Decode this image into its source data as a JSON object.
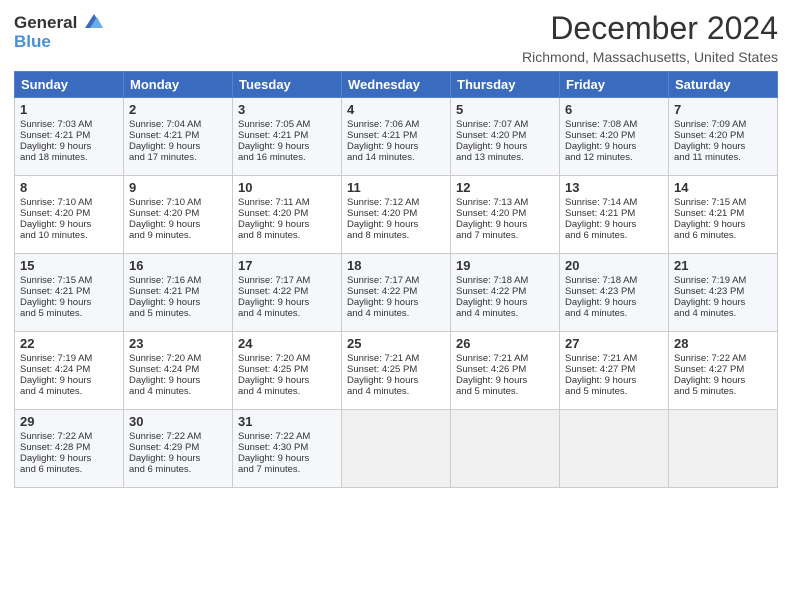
{
  "header": {
    "logo_general": "General",
    "logo_blue": "Blue",
    "month_title": "December 2024",
    "location": "Richmond, Massachusetts, United States"
  },
  "days_of_week": [
    "Sunday",
    "Monday",
    "Tuesday",
    "Wednesday",
    "Thursday",
    "Friday",
    "Saturday"
  ],
  "weeks": [
    [
      {
        "day": 1,
        "lines": [
          "Sunrise: 7:03 AM",
          "Sunset: 4:21 PM",
          "Daylight: 9 hours",
          "and 18 minutes."
        ]
      },
      {
        "day": 2,
        "lines": [
          "Sunrise: 7:04 AM",
          "Sunset: 4:21 PM",
          "Daylight: 9 hours",
          "and 17 minutes."
        ]
      },
      {
        "day": 3,
        "lines": [
          "Sunrise: 7:05 AM",
          "Sunset: 4:21 PM",
          "Daylight: 9 hours",
          "and 16 minutes."
        ]
      },
      {
        "day": 4,
        "lines": [
          "Sunrise: 7:06 AM",
          "Sunset: 4:21 PM",
          "Daylight: 9 hours",
          "and 14 minutes."
        ]
      },
      {
        "day": 5,
        "lines": [
          "Sunrise: 7:07 AM",
          "Sunset: 4:20 PM",
          "Daylight: 9 hours",
          "and 13 minutes."
        ]
      },
      {
        "day": 6,
        "lines": [
          "Sunrise: 7:08 AM",
          "Sunset: 4:20 PM",
          "Daylight: 9 hours",
          "and 12 minutes."
        ]
      },
      {
        "day": 7,
        "lines": [
          "Sunrise: 7:09 AM",
          "Sunset: 4:20 PM",
          "Daylight: 9 hours",
          "and 11 minutes."
        ]
      }
    ],
    [
      {
        "day": 8,
        "lines": [
          "Sunrise: 7:10 AM",
          "Sunset: 4:20 PM",
          "Daylight: 9 hours",
          "and 10 minutes."
        ]
      },
      {
        "day": 9,
        "lines": [
          "Sunrise: 7:10 AM",
          "Sunset: 4:20 PM",
          "Daylight: 9 hours",
          "and 9 minutes."
        ]
      },
      {
        "day": 10,
        "lines": [
          "Sunrise: 7:11 AM",
          "Sunset: 4:20 PM",
          "Daylight: 9 hours",
          "and 8 minutes."
        ]
      },
      {
        "day": 11,
        "lines": [
          "Sunrise: 7:12 AM",
          "Sunset: 4:20 PM",
          "Daylight: 9 hours",
          "and 8 minutes."
        ]
      },
      {
        "day": 12,
        "lines": [
          "Sunrise: 7:13 AM",
          "Sunset: 4:20 PM",
          "Daylight: 9 hours",
          "and 7 minutes."
        ]
      },
      {
        "day": 13,
        "lines": [
          "Sunrise: 7:14 AM",
          "Sunset: 4:21 PM",
          "Daylight: 9 hours",
          "and 6 minutes."
        ]
      },
      {
        "day": 14,
        "lines": [
          "Sunrise: 7:15 AM",
          "Sunset: 4:21 PM",
          "Daylight: 9 hours",
          "and 6 minutes."
        ]
      }
    ],
    [
      {
        "day": 15,
        "lines": [
          "Sunrise: 7:15 AM",
          "Sunset: 4:21 PM",
          "Daylight: 9 hours",
          "and 5 minutes."
        ]
      },
      {
        "day": 16,
        "lines": [
          "Sunrise: 7:16 AM",
          "Sunset: 4:21 PM",
          "Daylight: 9 hours",
          "and 5 minutes."
        ]
      },
      {
        "day": 17,
        "lines": [
          "Sunrise: 7:17 AM",
          "Sunset: 4:22 PM",
          "Daylight: 9 hours",
          "and 4 minutes."
        ]
      },
      {
        "day": 18,
        "lines": [
          "Sunrise: 7:17 AM",
          "Sunset: 4:22 PM",
          "Daylight: 9 hours",
          "and 4 minutes."
        ]
      },
      {
        "day": 19,
        "lines": [
          "Sunrise: 7:18 AM",
          "Sunset: 4:22 PM",
          "Daylight: 9 hours",
          "and 4 minutes."
        ]
      },
      {
        "day": 20,
        "lines": [
          "Sunrise: 7:18 AM",
          "Sunset: 4:23 PM",
          "Daylight: 9 hours",
          "and 4 minutes."
        ]
      },
      {
        "day": 21,
        "lines": [
          "Sunrise: 7:19 AM",
          "Sunset: 4:23 PM",
          "Daylight: 9 hours",
          "and 4 minutes."
        ]
      }
    ],
    [
      {
        "day": 22,
        "lines": [
          "Sunrise: 7:19 AM",
          "Sunset: 4:24 PM",
          "Daylight: 9 hours",
          "and 4 minutes."
        ]
      },
      {
        "day": 23,
        "lines": [
          "Sunrise: 7:20 AM",
          "Sunset: 4:24 PM",
          "Daylight: 9 hours",
          "and 4 minutes."
        ]
      },
      {
        "day": 24,
        "lines": [
          "Sunrise: 7:20 AM",
          "Sunset: 4:25 PM",
          "Daylight: 9 hours",
          "and 4 minutes."
        ]
      },
      {
        "day": 25,
        "lines": [
          "Sunrise: 7:21 AM",
          "Sunset: 4:25 PM",
          "Daylight: 9 hours",
          "and 4 minutes."
        ]
      },
      {
        "day": 26,
        "lines": [
          "Sunrise: 7:21 AM",
          "Sunset: 4:26 PM",
          "Daylight: 9 hours",
          "and 5 minutes."
        ]
      },
      {
        "day": 27,
        "lines": [
          "Sunrise: 7:21 AM",
          "Sunset: 4:27 PM",
          "Daylight: 9 hours",
          "and 5 minutes."
        ]
      },
      {
        "day": 28,
        "lines": [
          "Sunrise: 7:22 AM",
          "Sunset: 4:27 PM",
          "Daylight: 9 hours",
          "and 5 minutes."
        ]
      }
    ],
    [
      {
        "day": 29,
        "lines": [
          "Sunrise: 7:22 AM",
          "Sunset: 4:28 PM",
          "Daylight: 9 hours",
          "and 6 minutes."
        ]
      },
      {
        "day": 30,
        "lines": [
          "Sunrise: 7:22 AM",
          "Sunset: 4:29 PM",
          "Daylight: 9 hours",
          "and 6 minutes."
        ]
      },
      {
        "day": 31,
        "lines": [
          "Sunrise: 7:22 AM",
          "Sunset: 4:30 PM",
          "Daylight: 9 hours",
          "and 7 minutes."
        ]
      },
      null,
      null,
      null,
      null
    ]
  ]
}
